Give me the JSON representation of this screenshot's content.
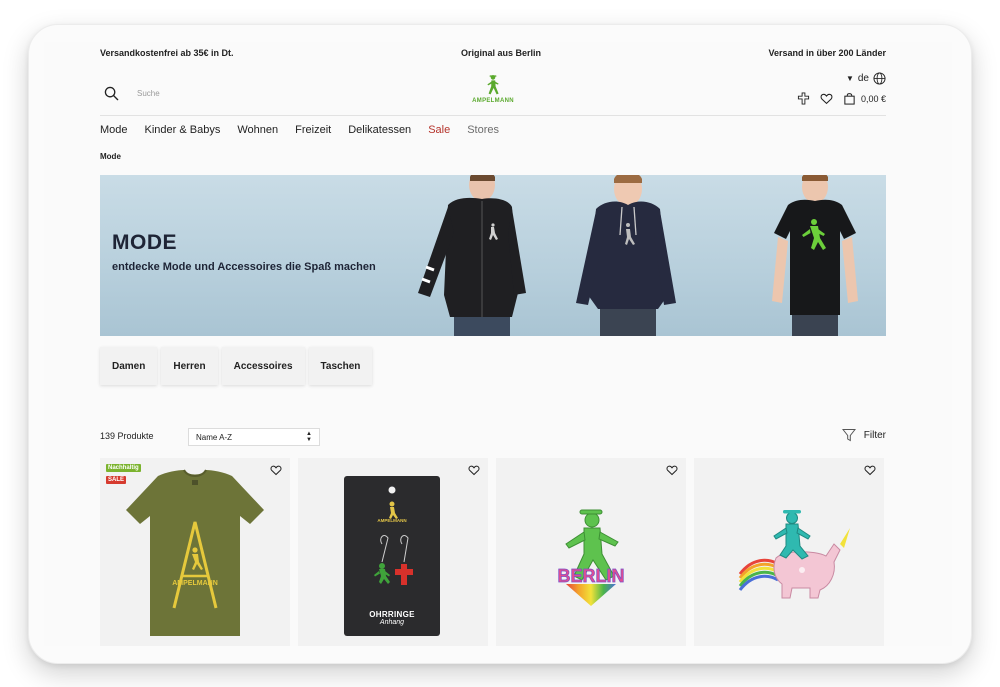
{
  "topbar": {
    "left": "Versandkostenfrei ab 35€ in Dt.",
    "center": "Original aus Berlin",
    "right": "Versand in über 200 Länder"
  },
  "header": {
    "search_placeholder": "Suche",
    "logo_text": "AMPELMANN",
    "language": "de",
    "cart_total": "0,00 €"
  },
  "nav": {
    "items": [
      "Mode",
      "Kinder & Babys",
      "Wohnen",
      "Freizeit",
      "Delikatessen",
      "Sale",
      "Stores"
    ]
  },
  "breadcrumb": "Mode",
  "banner": {
    "title": "MODE",
    "subtitle": "entdecke Mode und Accessoires die Spaß machen"
  },
  "categories": [
    "Damen",
    "Herren",
    "Accessoires",
    "Taschen"
  ],
  "toolbar": {
    "count": "139 Produkte",
    "sort_value": "Name A-Z",
    "filter_label": "Filter"
  },
  "products": [
    {
      "badges": [
        "Nachhaltig",
        "SALE"
      ],
      "print_text": "AMPELMANN"
    },
    {
      "package_brand": "AMPELMANN",
      "package_title": "OHRRINGE",
      "package_subtitle": "Anhang"
    },
    {
      "pin_text": "BERLIN"
    },
    {}
  ],
  "colors": {
    "accent_green": "#5aa92d",
    "sale_red": "#b5342c",
    "badge_green": "#7bb32e",
    "badge_red": "#d63b2f"
  }
}
